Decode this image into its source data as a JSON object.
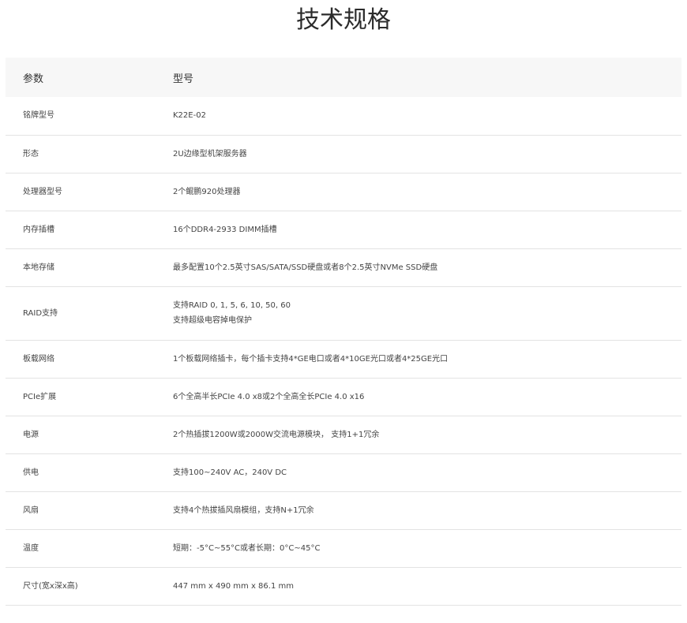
{
  "title": "技术规格",
  "table": {
    "headers": [
      "参数",
      "型号"
    ],
    "rows": [
      {
        "param": "铭牌型号",
        "lines": [
          "K22E-02"
        ]
      },
      {
        "param": "形态",
        "lines": [
          "2U边缘型机架服务器"
        ]
      },
      {
        "param": "处理器型号",
        "lines": [
          "2个鲲鹏920处理器"
        ]
      },
      {
        "param": "内存插槽",
        "lines": [
          "16个DDR4-2933 DIMM插槽"
        ]
      },
      {
        "param": "本地存储",
        "lines": [
          "最多配置10个2.5英寸SAS/SATA/SSD硬盘或者8个2.5英寸NVMe SSD硬盘"
        ]
      },
      {
        "param": "RAID支持",
        "lines": [
          "支持RAID 0, 1, 5, 6, 10, 50, 60",
          "支持超级电容掉电保护"
        ]
      },
      {
        "param": "板载网络",
        "lines": [
          "1个板载网络插卡，每个插卡支持4*GE电口或者4*10GE光口或者4*25GE光口"
        ]
      },
      {
        "param": "PCIe扩展",
        "lines": [
          "6个全高半长PCIe 4.0 x8或2个全高全长PCIe 4.0 x16"
        ]
      },
      {
        "param": "电源",
        "lines": [
          "2个热插拔1200W或2000W交流电源模块， 支持1+1冗余"
        ]
      },
      {
        "param": "供电",
        "lines": [
          "支持100~240V AC，240V DC"
        ]
      },
      {
        "param": "风扇",
        "lines": [
          "支持4个热拔插风扇模组，支持N+1冗余"
        ]
      },
      {
        "param": "温度",
        "lines": [
          "短期：-5°C~55°C或者长期：0°C~45°C"
        ]
      },
      {
        "param": "尺寸(宽x深x高)",
        "lines": [
          "447 mm x 490 mm x 86.1 mm"
        ]
      }
    ]
  }
}
